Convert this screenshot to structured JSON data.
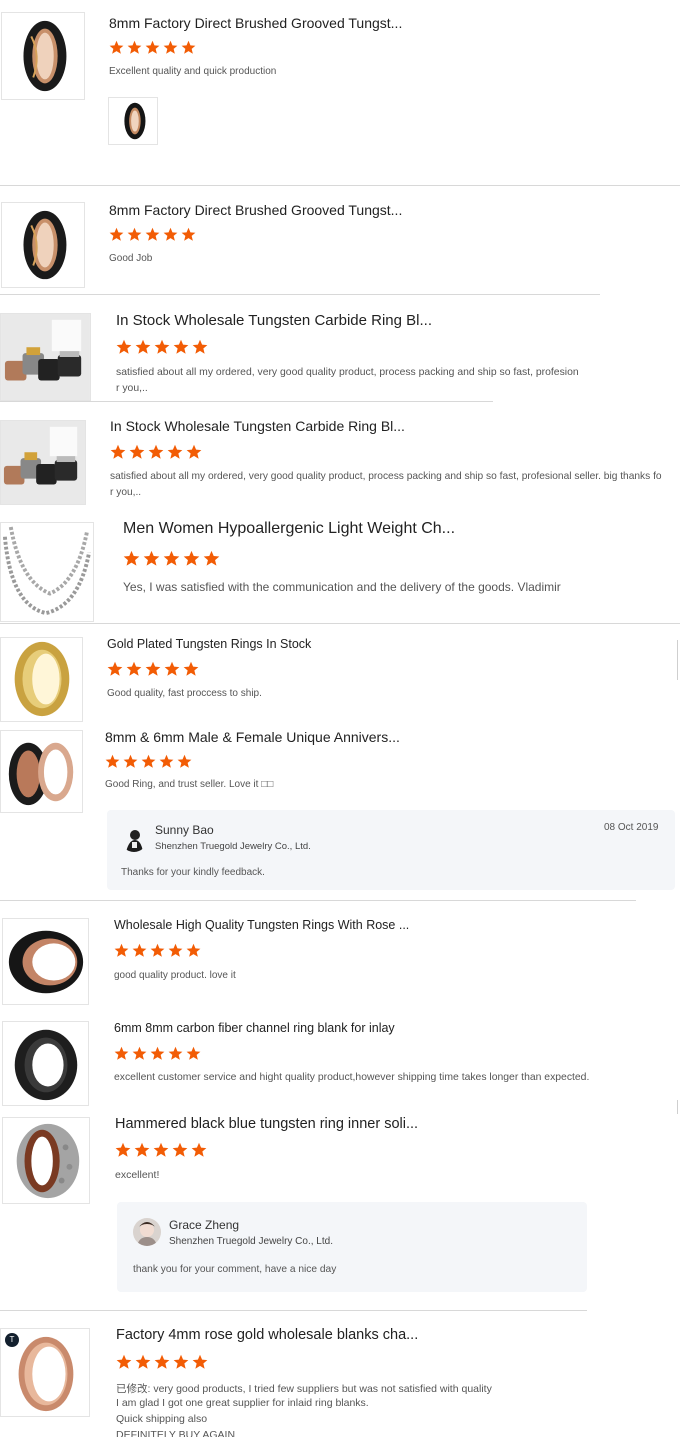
{
  "colors": {
    "star": "#f25c05",
    "divider": "#d8d8d8",
    "reply_bg": "#f4f6f9"
  },
  "reviews": [
    {
      "title": "8mm Factory Direct Brushed Grooved Tungst...",
      "rating": 5,
      "comment": "Excellent quality and quick production",
      "icon": "ring-black-gold-stripe"
    },
    {
      "title": "8mm Factory Direct Brushed Grooved Tungst...",
      "rating": 5,
      "comment": "Good Job",
      "icon": "ring-black-gold-stripe"
    },
    {
      "title": "In Stock Wholesale Tungsten Carbide Ring Bl...",
      "rating": 5,
      "comment": "satisfied about all my ordered, very good quality product, process packing and ship so fast, profesion",
      "comment2": "r you,..",
      "icon": "ring-blanks-set"
    },
    {
      "title": "In Stock Wholesale Tungsten Carbide Ring Bl...",
      "rating": 5,
      "comment": "satisfied about all my ordered, very good quality product, process packing and ship so fast, profesional seller. big thanks fo",
      "comment2": "r you,..",
      "icon": "ring-blanks-set"
    },
    {
      "title": "Men Women Hypoallergenic Light Weight Ch...",
      "rating": 5,
      "comment": "Yes, I was satisfied with the communication and the delivery of the goods. Vladimir",
      "icon": "silver-chain"
    },
    {
      "title": "Gold Plated Tungsten Rings In Stock",
      "rating": 5,
      "comment": "Good quality, fast proccess to ship.",
      "icon": "gold-ring"
    },
    {
      "title": "8mm & 6mm Male & Female Unique Annivers...",
      "rating": 5,
      "comment": "Good Ring, and trust seller. Love it □□",
      "icon": "rose-gold-ring-pair"
    },
    {
      "title": "Wholesale High Quality Tungsten Rings With Rose ...",
      "rating": 5,
      "comment": "good quality product. love it",
      "icon": "black-rose-ring"
    },
    {
      "title": "6mm 8mm carbon fiber channel ring blank for inlay",
      "rating": 5,
      "comment": "excellent customer service and hight quality product,however shipping time takes longer than expected.",
      "icon": "carbon-channel-ring"
    },
    {
      "title": "Hammered black blue tungsten ring inner soli...",
      "rating": 5,
      "comment": "excellent!",
      "icon": "hammered-wood-ring"
    },
    {
      "title": "Factory 4mm rose gold wholesale blanks cha...",
      "rating": 5,
      "comment_lines": [
        "已修改: very good products, I tried few suppliers but was not satisfied with quality",
        "I am glad I got one great supplier for inlaid ring blanks.",
        "Quick shipping also",
        "DEFINITELY BUY AGAIN"
      ],
      "icon": "rose-gold-thin-ring",
      "badge": "T"
    }
  ],
  "replies": [
    {
      "name": "Sunny Bao",
      "company": "Shenzhen Truegold Jewelry Co., Ltd.",
      "date": "08 Oct 2019",
      "text": "Thanks for your kindly feedback."
    },
    {
      "name": "Grace Zheng",
      "company": "Shenzhen Truegold Jewelry Co., Ltd.",
      "text": "thank you for your comment, have a nice day"
    }
  ]
}
